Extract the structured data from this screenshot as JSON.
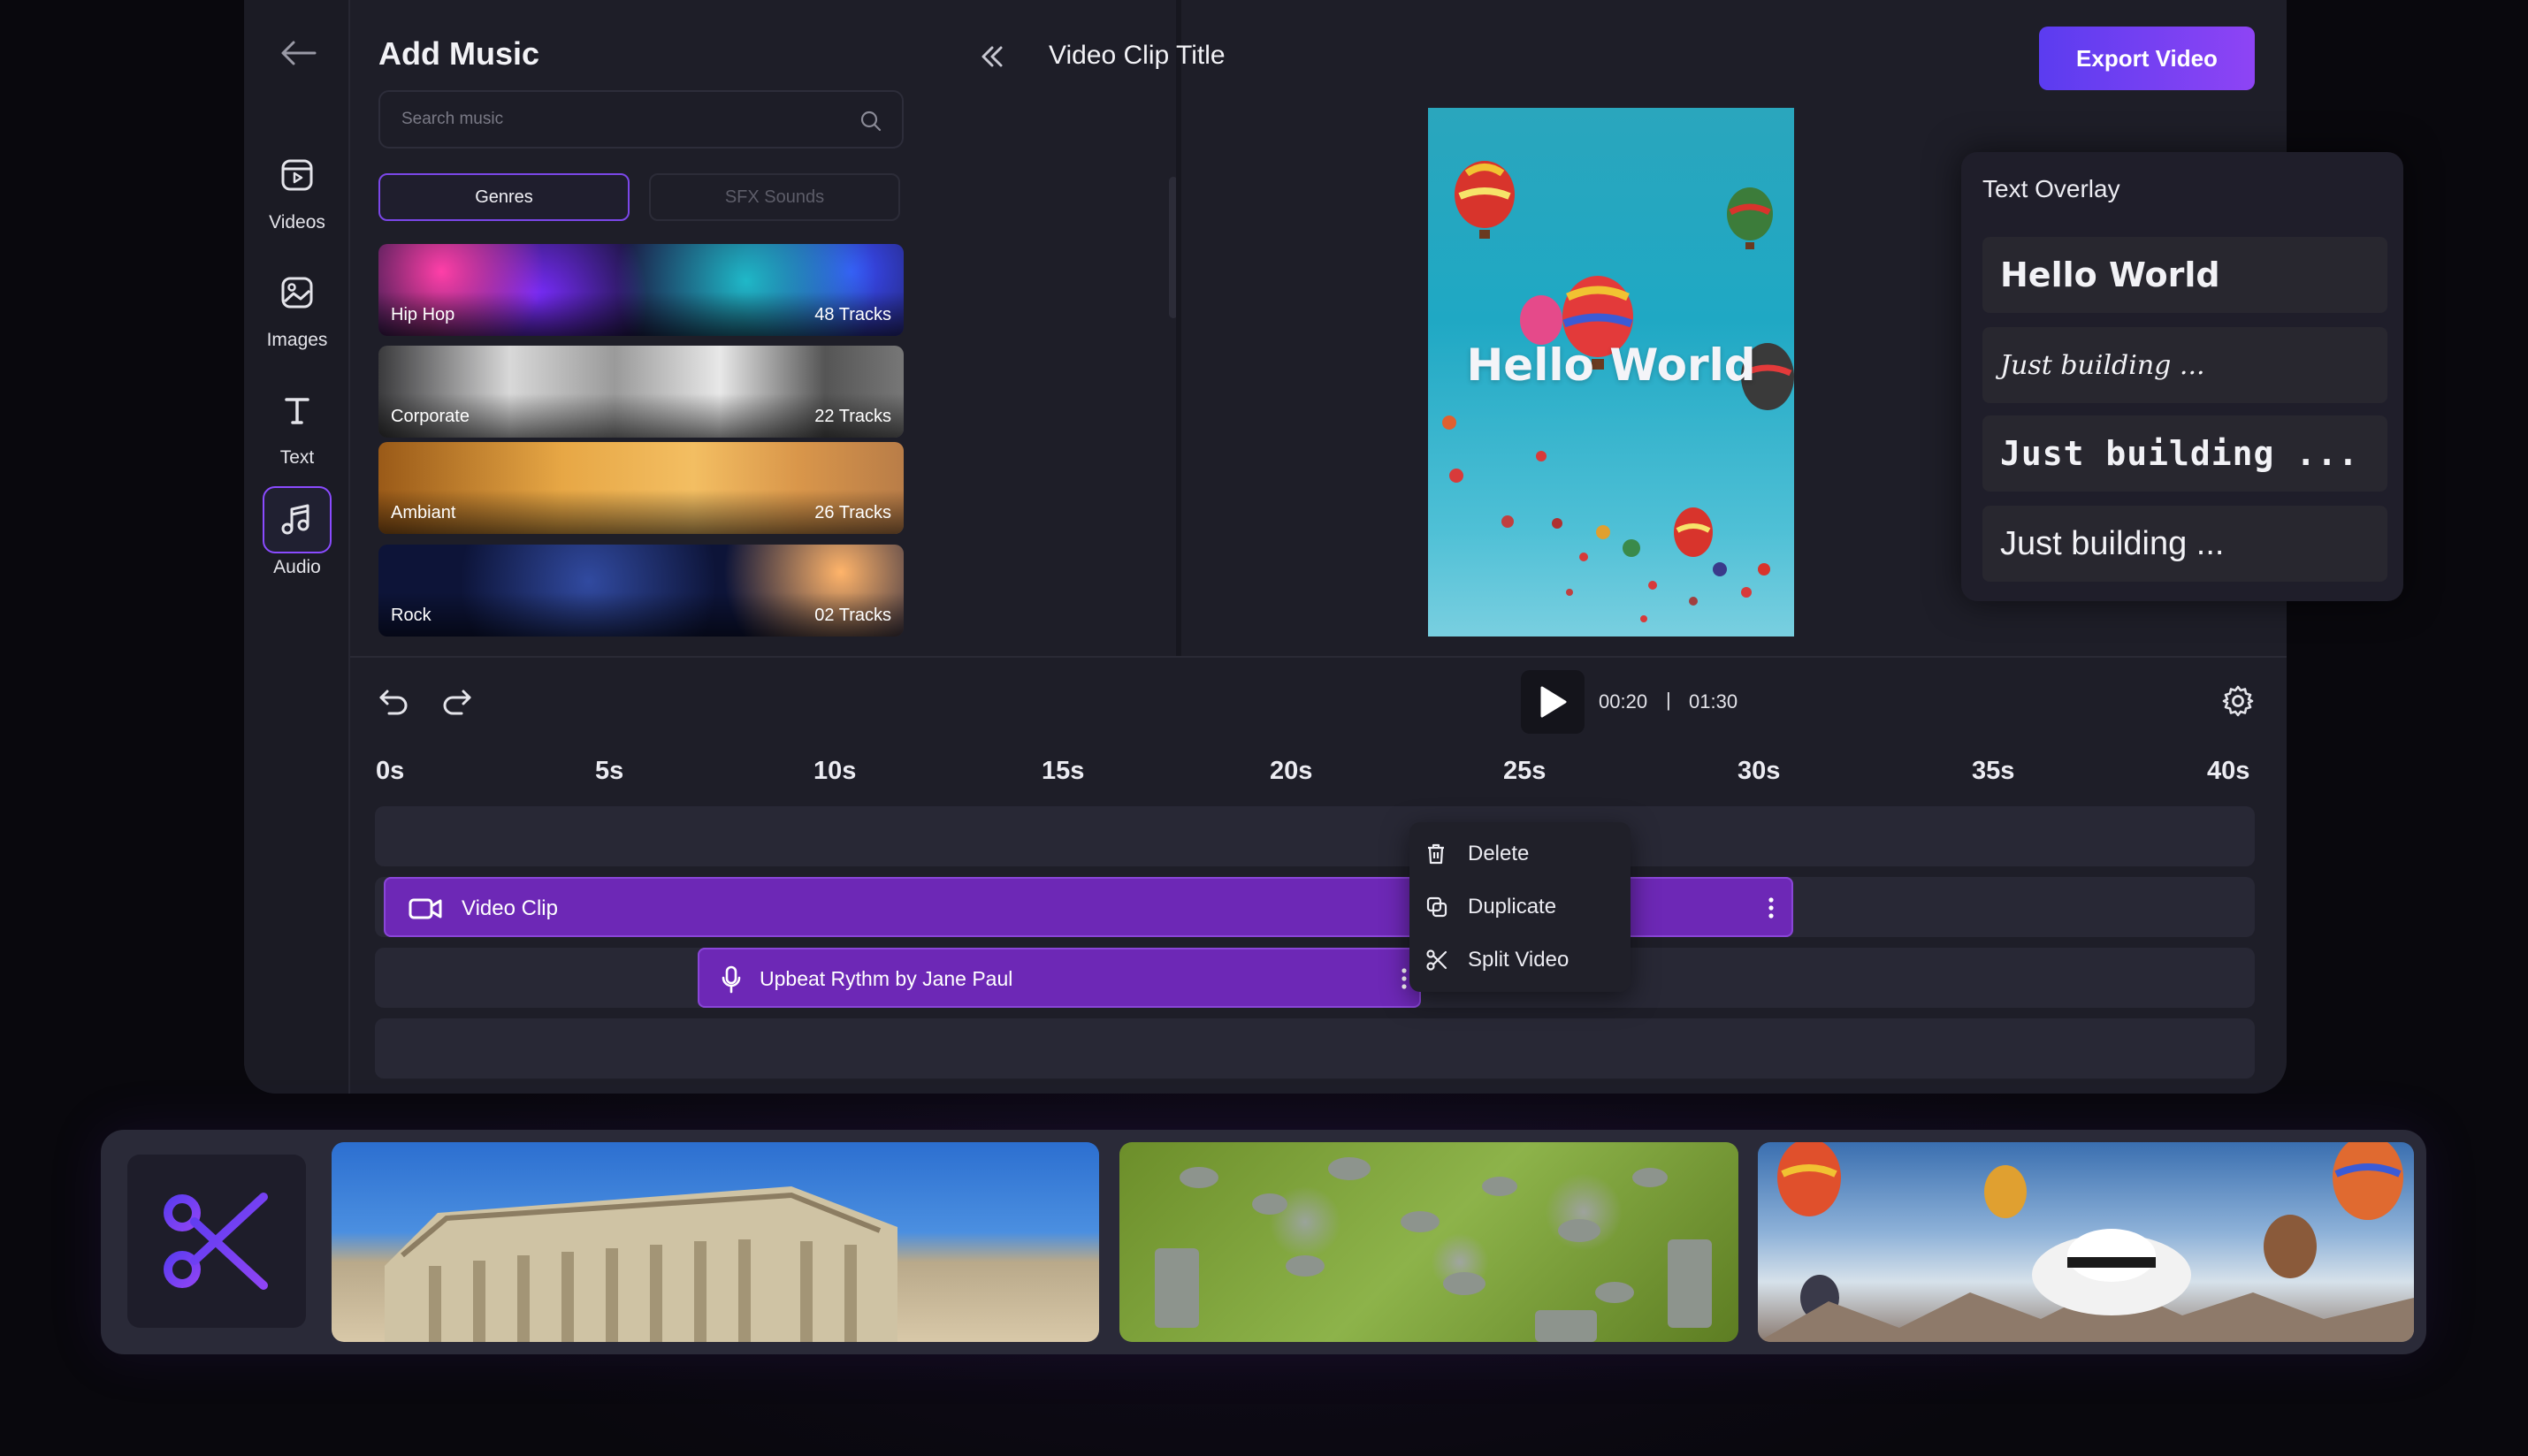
{
  "sidebar": {
    "items": [
      {
        "label": "Videos",
        "icon": "video-icon"
      },
      {
        "label": "Images",
        "icon": "image-icon"
      },
      {
        "label": "Text",
        "icon": "text-icon"
      },
      {
        "label": "Audio",
        "icon": "music-icon",
        "active": true
      }
    ]
  },
  "music_panel": {
    "title": "Add Music",
    "search_placeholder": "Search music",
    "tabs": [
      {
        "label": "Genres",
        "active": true
      },
      {
        "label": "SFX Sounds",
        "active": false
      }
    ],
    "genres": [
      {
        "name": "Hip Hop",
        "tracks": "48 Tracks"
      },
      {
        "name": "Corporate",
        "tracks": "22 Tracks"
      },
      {
        "name": "Ambiant",
        "tracks": "26 Tracks"
      },
      {
        "name": "Rock",
        "tracks": "02 Tracks"
      }
    ]
  },
  "header": {
    "clip_title": "Video Clip Title",
    "export_label": "Export Video"
  },
  "preview": {
    "overlay_text": "Hello World"
  },
  "text_overlay": {
    "title": "Text Overlay",
    "options": [
      "Hello World",
      "Just building ...",
      "Just building ...",
      "Just building ..."
    ]
  },
  "playback": {
    "current_time": "00:20",
    "separator": "|",
    "total_time": "01:30"
  },
  "timeline": {
    "ruler": [
      "0s",
      "5s",
      "10s",
      "15s",
      "20s",
      "25s",
      "30s",
      "35s",
      "40s"
    ],
    "video_clip_label": "Video Clip",
    "audio_clip_label": "Upbeat Rythm by Jane Paul"
  },
  "context_menu": {
    "items": [
      {
        "label": "Delete",
        "icon": "trash-icon"
      },
      {
        "label": "Duplicate",
        "icon": "duplicate-icon"
      },
      {
        "label": "Split Video",
        "icon": "scissors-icon"
      }
    ]
  },
  "colors": {
    "accent": "#8a46d8",
    "export_gradient_start": "#5b3cf0",
    "export_gradient_end": "#8e44f4",
    "background": "#1e1e28"
  }
}
